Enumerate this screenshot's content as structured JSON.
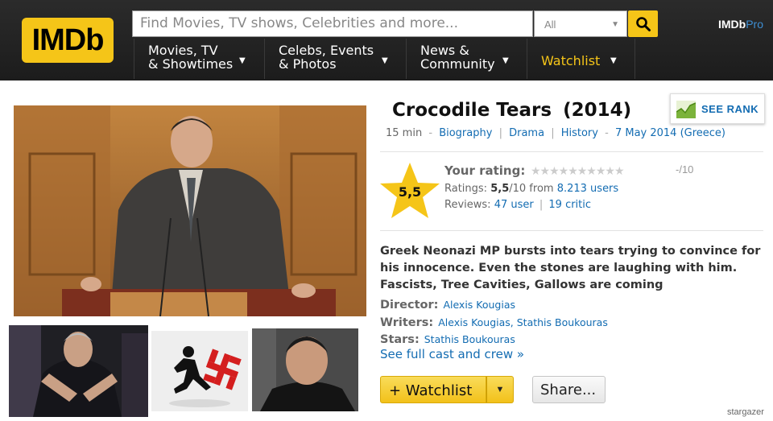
{
  "header": {
    "logo": "IMDb",
    "search_placeholder": "Find Movies, TV shows, Celebrities and more...",
    "search_category": "All",
    "pro_prefix": "IMDb",
    "pro_suffix": "Pro",
    "nav": [
      {
        "line1": "Movies, TV",
        "line2": "& Showtimes"
      },
      {
        "line1": "Celebs, Events",
        "line2": "& Photos"
      },
      {
        "line1": "News &",
        "line2": "Community"
      },
      {
        "line1": "Watchlist",
        "line2": ""
      }
    ]
  },
  "title": {
    "name": "Crocodile Tears",
    "year": "(2014)"
  },
  "see_rank_label": "SEE RANK",
  "meta": {
    "duration": "15 min",
    "genres": [
      "Biography",
      "Drama",
      "History"
    ],
    "release": "7 May 2014 (Greece)"
  },
  "rating": {
    "value": "5,5",
    "your_rating_label": "Your rating:",
    "your_rating_value": "-/10",
    "ratings_prefix": "Ratings:",
    "score": "5,5",
    "out_of": "/10 from",
    "users": "8.213 users",
    "reviews_label": "Reviews:",
    "user_reviews": "47 user",
    "critic_reviews": "19 critic"
  },
  "description": "Greek Neonazi MP bursts into tears trying to convince for his innocence. Even the stones are laughing with him. Fascists, Tree Cavities, Gallows are coming",
  "credits": {
    "director_label": "Director:",
    "director": "Alexis Kougias",
    "writers_label": "Writers:",
    "writers": "Alexis Kougias, Stathis Boukouras",
    "stars_label": "Stars:",
    "stars": "Stathis Boukouras",
    "full_cast": "See full cast and crew »"
  },
  "buttons": {
    "watchlist": "+ Watchlist",
    "share": "Share..."
  },
  "watermark": "stargazer"
}
